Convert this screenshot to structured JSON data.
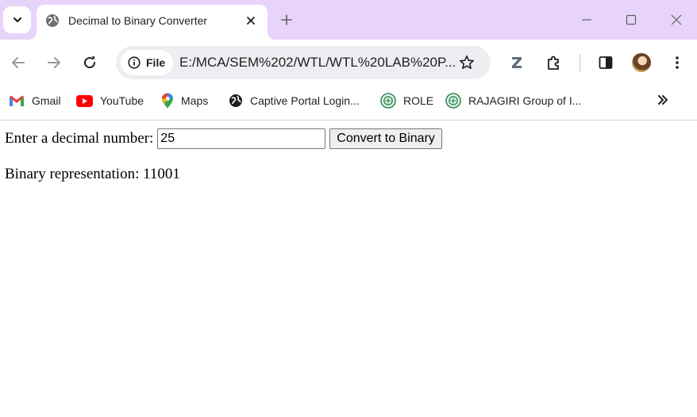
{
  "browser": {
    "tab": {
      "title": "Decimal to Binary Converter"
    },
    "omnibox": {
      "chip_label": "File",
      "url": "E:/MCA/SEM%202/WTL/WTL%20LAB%20P..."
    },
    "bookmarks": [
      {
        "label": "Gmail",
        "icon": "gmail-icon"
      },
      {
        "label": "YouTube",
        "icon": "youtube-icon"
      },
      {
        "label": "Maps",
        "icon": "maps-icon"
      },
      {
        "label": "Captive Portal Login...",
        "icon": "globe-icon"
      },
      {
        "label": "ROLE",
        "icon": "rajagiri-logo-icon"
      },
      {
        "label": "RAJAGIRI Group of I...",
        "icon": "rajagiri-logo-icon"
      }
    ],
    "colors": {
      "frame": "#e8d4fa",
      "omnibox": "#efedf1"
    }
  },
  "page": {
    "input_label": "Enter a decimal number:",
    "input_value": "25",
    "button_label": "Convert to Binary",
    "result_text": "Binary representation: 11001"
  }
}
